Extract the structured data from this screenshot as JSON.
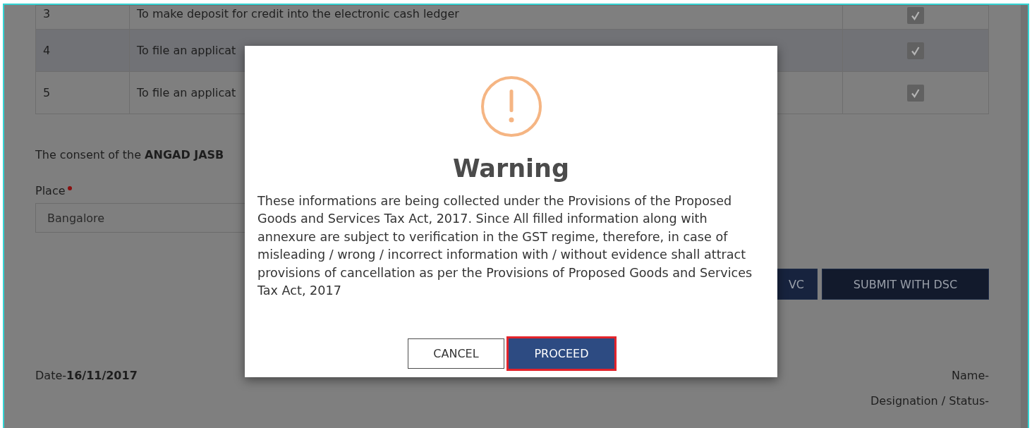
{
  "table": {
    "rows": [
      {
        "number": "3",
        "text": "To make deposit for credit into the electronic cash ledger",
        "checked": true,
        "highlighted": false
      },
      {
        "number": "4",
        "text": "To file an applicat",
        "checked": true,
        "highlighted": true
      },
      {
        "number": "5",
        "text": "To file an applicat",
        "checked": true,
        "highlighted": false
      }
    ]
  },
  "consent": "The consent of the **ANGAD JASB**",
  "place": {
    "label": "Place",
    "required": true,
    "value": "Bangalore"
  },
  "buttons": [
    "VC",
    "SUBMIT WITH DSC"
  ],
  "date": {
    "label": "Date-",
    "value": "16/11/2017"
  },
  "signature": [
    "Name-",
    "Designation / Status-"
  ],
  "dialog": {
    "title": "Warning",
    "message": "These informations are being collected under the Provisions of the Proposed Goods and Services Tax Act, 2017. Since All filled information along with annexure are subject to verification in the GST regime, therefore, in case of misleading / wrong / incorrect information with / without evidence shall attract provisions of cancellation as per the Provisions of Proposed Goods and Services Tax Act, 2017",
    "buttons": [
      {
        "label": "CANCEL",
        "kind": "secondary",
        "selected": false
      },
      {
        "label": "PROCEED",
        "kind": "primary",
        "selected": true
      }
    ]
  }
}
